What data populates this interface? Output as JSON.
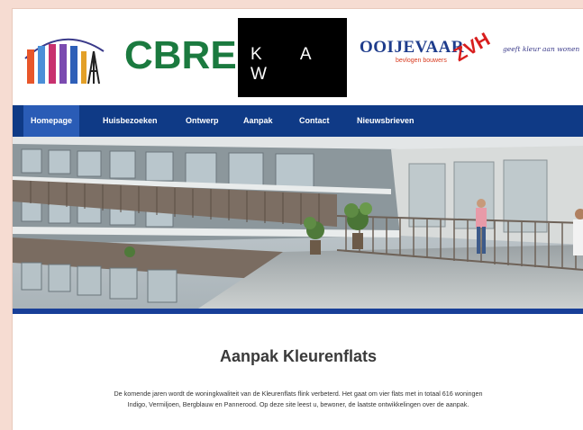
{
  "logos": {
    "cbre": "CBRE",
    "kaw": "K A W",
    "ooijevaar": "OOIJEVAAR",
    "ooijevaar_sub": "bevlogen bouwers",
    "zvh": "ZVH",
    "zvh_tagline": "geeft kleur aan wonen"
  },
  "nav": {
    "items": [
      {
        "label": "Homepage",
        "active": true
      },
      {
        "label": "Huisbezoeken"
      },
      {
        "label": "Ontwerp"
      },
      {
        "label": "Aanpak"
      },
      {
        "label": "Contact"
      },
      {
        "label": "Nieuwsbrieven"
      }
    ]
  },
  "colors": {
    "page_bg": "#f6dcd2",
    "nav_bg": "#0f3a86",
    "nav_active": "#2a5cb6",
    "cbre_green": "#1b7a3f"
  },
  "content": {
    "title": "Aanpak Kleurenflats",
    "line1": "De komende jaren wordt de woningkwaliteit van de Kleurenflats flink verbeterd. Het gaat om vier flats met in totaal 616 woningen",
    "line2": "Indigo, Vermiljoen, Bergblauw en Pannerood. Op deze site leest u, bewoner, de laatste ontwikkelingen over de aanpak."
  }
}
